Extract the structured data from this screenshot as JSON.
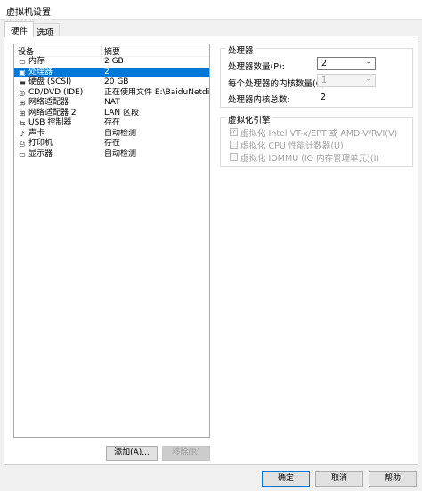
{
  "window": {
    "title": "虚拟机设置"
  },
  "tabs": [
    {
      "label": "硬件",
      "active": true
    },
    {
      "label": "选项",
      "active": false
    }
  ],
  "device_list": {
    "columns": [
      "设备",
      "摘要"
    ],
    "rows": [
      {
        "icon": "memory-icon",
        "device": "内存",
        "summary": "2 GB",
        "selected": false
      },
      {
        "icon": "processor-icon",
        "device": "处理器",
        "summary": "2",
        "selected": true
      },
      {
        "icon": "hard-disk-icon",
        "device": "硬盘 (SCSI)",
        "summary": "20 GB",
        "selected": false
      },
      {
        "icon": "cd-dvd-icon",
        "device": "CD/DVD (IDE)",
        "summary": "正在使用文件 E:\\BaiduNetdis...",
        "selected": false
      },
      {
        "icon": "network-adapter-icon",
        "device": "网络适配器",
        "summary": "NAT",
        "selected": false
      },
      {
        "icon": "network-adapter-icon",
        "device": "网络适配器 2",
        "summary": "LAN 区段",
        "selected": false
      },
      {
        "icon": "usb-icon",
        "device": "USB 控制器",
        "summary": "存在",
        "selected": false
      },
      {
        "icon": "sound-card-icon",
        "device": "声卡",
        "summary": "自动检测",
        "selected": false
      },
      {
        "icon": "printer-icon",
        "device": "打印机",
        "summary": "存在",
        "selected": false
      },
      {
        "icon": "display-icon",
        "device": "显示器",
        "summary": "自动检测",
        "selected": false
      }
    ],
    "add_button": "添加(A)...",
    "remove_button": "移除(R)"
  },
  "processor": {
    "group_title": "处理器",
    "count_label": "处理器数量(P):",
    "count_value": "2",
    "cores_label": "每个处理器的内核数量(C):",
    "cores_value": "1",
    "total_label": "处理器内核总数:",
    "total_value": "2"
  },
  "virtualization": {
    "group_title": "虚拟化引擎",
    "options": [
      {
        "label": "虚拟化 Intel VT-x/EPT 或 AMD-V/RVI(V)",
        "checked": true,
        "enabled": false
      },
      {
        "label": "虚拟化 CPU 性能计数器(U)",
        "checked": false,
        "enabled": false
      },
      {
        "label": "虚拟化 IOMMU (IO 内存管理单元)(I)",
        "checked": false,
        "enabled": false
      }
    ]
  },
  "footer": {
    "ok": "确定",
    "cancel": "取消",
    "help": "帮助"
  }
}
